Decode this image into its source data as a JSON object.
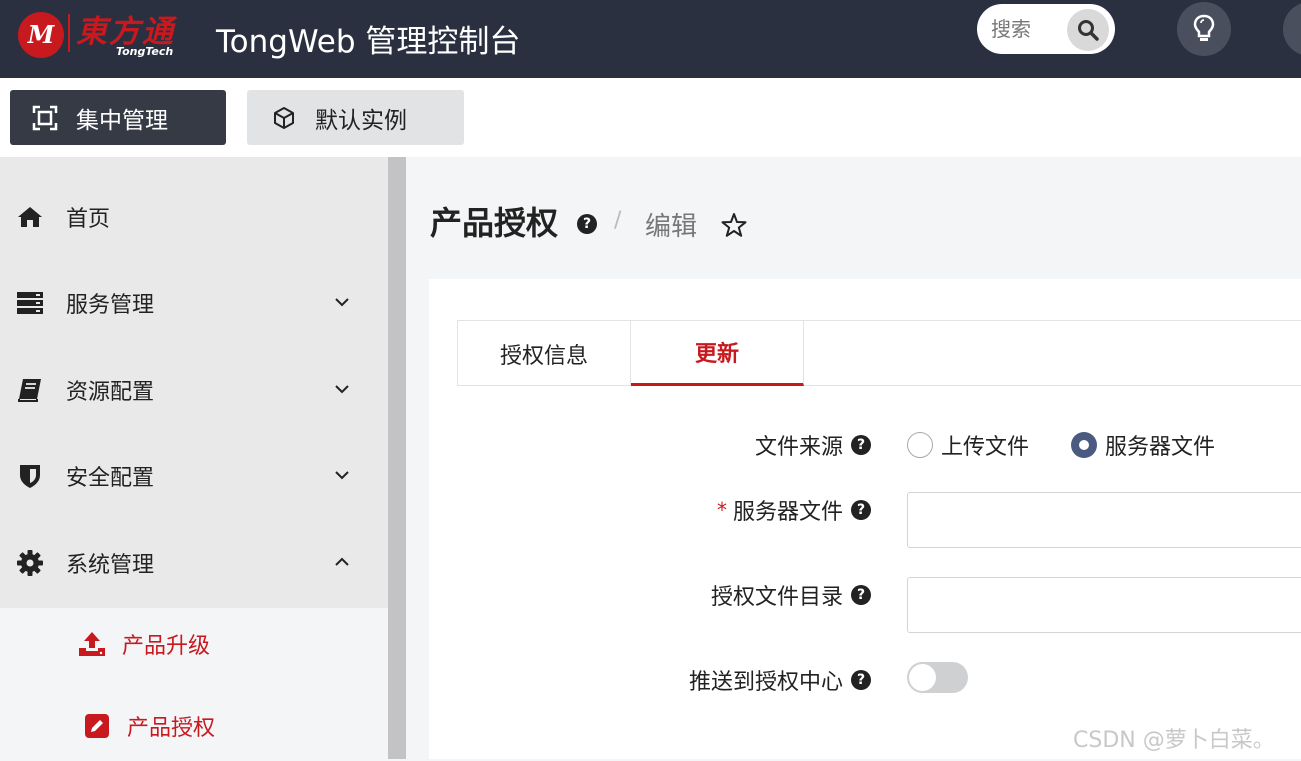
{
  "header": {
    "logo_mark": "M",
    "logo_cn": "東方通",
    "logo_en": "TongTech",
    "title": "TongWeb 管理控制台",
    "search_placeholder": "搜索"
  },
  "modes": {
    "active": "集中管理",
    "inactive": "默认实例"
  },
  "sidebar": {
    "items": [
      {
        "label": "首页",
        "icon": "home-icon"
      },
      {
        "label": "服务管理",
        "icon": "server-icon",
        "chevron": "down"
      },
      {
        "label": "资源配置",
        "icon": "book-icon",
        "chevron": "down"
      },
      {
        "label": "安全配置",
        "icon": "shield-icon",
        "chevron": "down"
      },
      {
        "label": "系统管理",
        "icon": "gear-icon",
        "chevron": "up"
      }
    ],
    "sub_items": [
      {
        "label": "产品升级",
        "icon": "upload-icon"
      },
      {
        "label": "产品授权",
        "icon": "edit-icon"
      }
    ]
  },
  "page": {
    "title": "产品授权",
    "breadcrumb_sep": "/",
    "breadcrumb_current": "编辑"
  },
  "tabs": [
    "授权信息",
    "更新"
  ],
  "form": {
    "file_source_label": "文件来源",
    "radio_upload": "上传文件",
    "radio_server": "服务器文件",
    "selected_source": "服务器文件",
    "server_file_label": "服务器文件",
    "server_file_required": "*",
    "server_file_value": "",
    "license_dir_label": "授权文件目录",
    "license_dir_value": "",
    "push_label": "推送到授权中心",
    "push_enabled": false
  },
  "help_glyph": "?",
  "watermark": "CSDN @萝卜白菜。",
  "colors": {
    "header_bg": "#2b3040",
    "accent": "#c8191f",
    "radio_selected": "#4a5a80"
  }
}
